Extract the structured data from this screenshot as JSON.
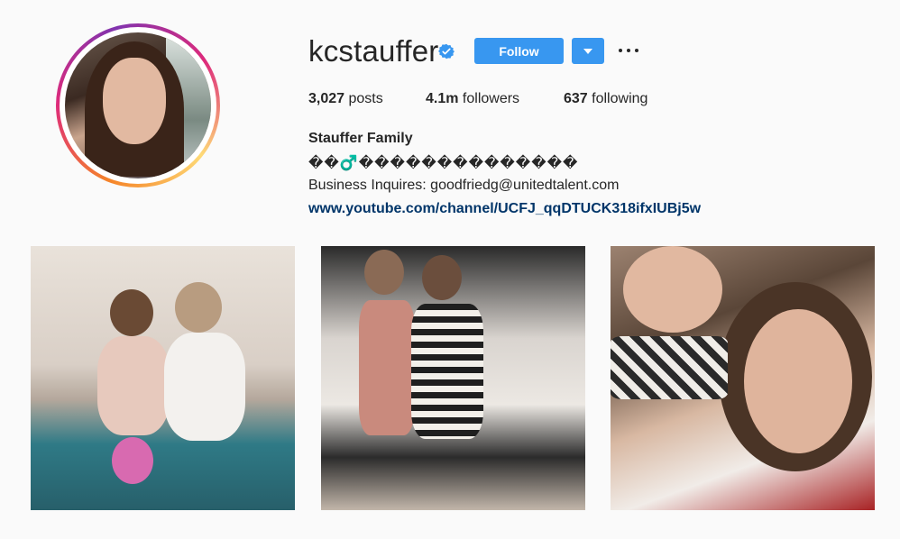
{
  "profile": {
    "username": "kcstauffer",
    "verified": true,
    "follow_label": "Follow",
    "stats": {
      "posts_count": "3,027",
      "posts_label": "posts",
      "followers_count": "4.1m",
      "followers_label": "followers",
      "following_count": "637",
      "following_label": "following"
    },
    "bio": {
      "name": "Stauffer Family",
      "emoji_line": "��‍♂️��������������",
      "business": "Business Inquires: goodfriedg@unitedtalent.com",
      "link": "www.youtube.com/channel/UCFJ_qqDTUCK318ifxIUBj5w"
    }
  },
  "icons": {
    "verified": "verified-badge-icon",
    "dropdown": "chevron-down-icon",
    "more": "more-options-icon"
  },
  "colors": {
    "accent": "#3897f0",
    "link": "#003569",
    "background": "#fafafa"
  }
}
